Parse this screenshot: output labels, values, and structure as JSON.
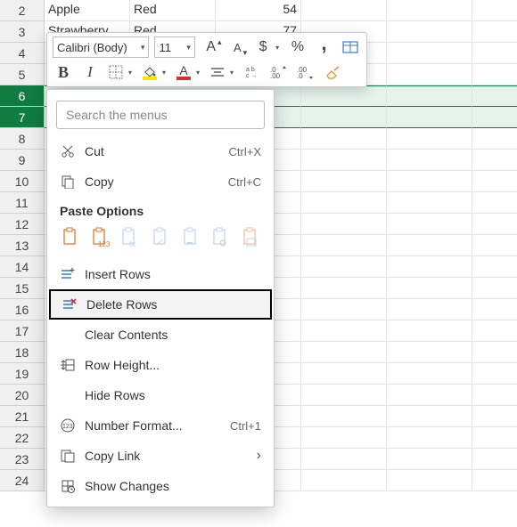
{
  "grid": {
    "rows": [
      {
        "num": 2,
        "cells": [
          "Apple",
          "Red",
          "54"
        ],
        "selected": false
      },
      {
        "num": 3,
        "cells": [
          "Strawberry",
          "Red",
          "77"
        ],
        "selected": false
      },
      {
        "num": 4,
        "cells": [
          "",
          "",
          ""
        ],
        "selected": false
      },
      {
        "num": 5,
        "cells": [
          "",
          "",
          ""
        ],
        "selected": false
      },
      {
        "num": 6,
        "cells": [
          "",
          "",
          ""
        ],
        "selected": true
      },
      {
        "num": 7,
        "cells": [
          "",
          "",
          ""
        ],
        "selected": true
      },
      {
        "num": 8,
        "cells": [
          "",
          "",
          ""
        ],
        "selected": false
      },
      {
        "num": 9,
        "cells": [
          "",
          "",
          ""
        ],
        "selected": false
      },
      {
        "num": 10,
        "cells": [
          "",
          "",
          ""
        ],
        "selected": false
      },
      {
        "num": 11,
        "cells": [
          "",
          "",
          ""
        ],
        "selected": false
      },
      {
        "num": 12,
        "cells": [
          "",
          "",
          ""
        ],
        "selected": false
      },
      {
        "num": 13,
        "cells": [
          "",
          "",
          ""
        ],
        "selected": false
      },
      {
        "num": 14,
        "cells": [
          "",
          "",
          ""
        ],
        "selected": false
      },
      {
        "num": 15,
        "cells": [
          "",
          "",
          ""
        ],
        "selected": false
      },
      {
        "num": 16,
        "cells": [
          "",
          "",
          ""
        ],
        "selected": false
      },
      {
        "num": 17,
        "cells": [
          "",
          "",
          ""
        ],
        "selected": false
      },
      {
        "num": 18,
        "cells": [
          "",
          "",
          ""
        ],
        "selected": false
      },
      {
        "num": 19,
        "cells": [
          "",
          "",
          ""
        ],
        "selected": false
      },
      {
        "num": 20,
        "cells": [
          "",
          "",
          ""
        ],
        "selected": false
      },
      {
        "num": 21,
        "cells": [
          "",
          "",
          ""
        ],
        "selected": false
      },
      {
        "num": 22,
        "cells": [
          "",
          "",
          ""
        ],
        "selected": false
      },
      {
        "num": 23,
        "cells": [
          "",
          "",
          ""
        ],
        "selected": false
      },
      {
        "num": 24,
        "cells": [
          "",
          "",
          ""
        ],
        "selected": false
      }
    ]
  },
  "mini_toolbar": {
    "font_name": "Calibri (Body)",
    "font_size": "11",
    "increase_font": "A",
    "decrease_font": "A",
    "currency": "$",
    "percent": "%",
    "comma": ",",
    "bold": "B",
    "italic": "I",
    "font_color_letter": "A"
  },
  "context_menu": {
    "search_placeholder": "Search the menus",
    "cut": {
      "label": "Cut",
      "shortcut": "Ctrl+X"
    },
    "copy": {
      "label": "Copy",
      "shortcut": "Ctrl+C"
    },
    "paste_heading": "Paste Options",
    "insert_rows": "Insert Rows",
    "delete_rows": "Delete Rows",
    "clear_contents": "Clear Contents",
    "row_height": "Row Height...",
    "hide_rows": "Hide Rows",
    "number_format": {
      "label": "Number Format...",
      "shortcut": "Ctrl+1"
    },
    "copy_link": "Copy Link",
    "show_changes": "Show Changes"
  }
}
